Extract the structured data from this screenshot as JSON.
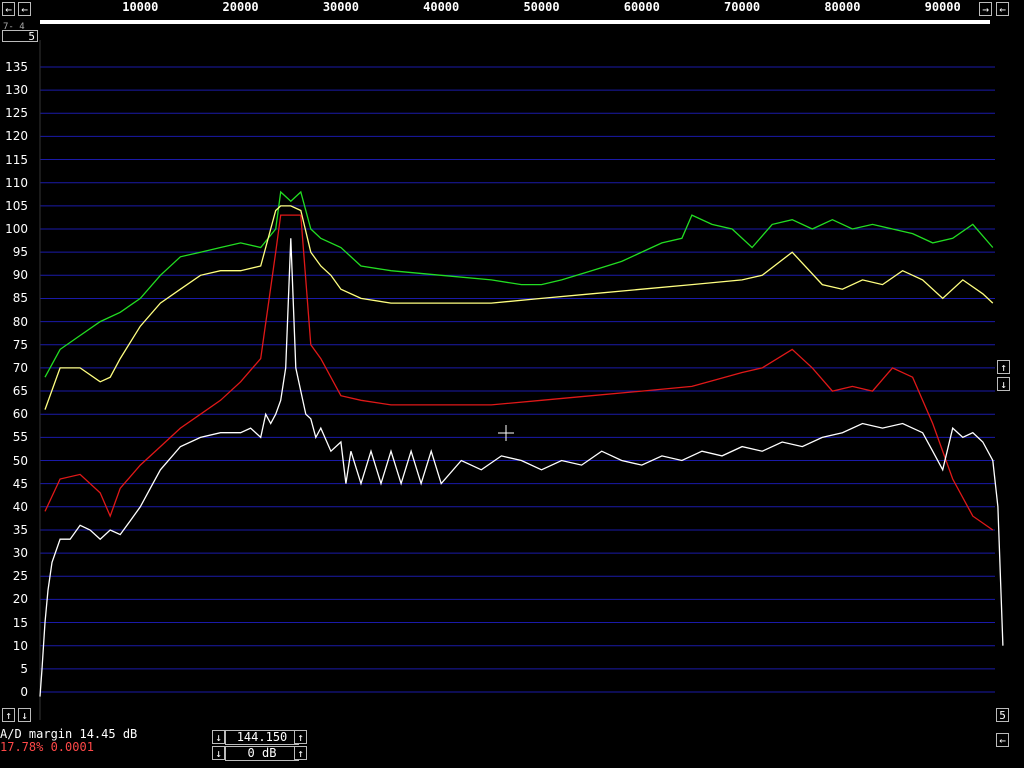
{
  "x_axis": {
    "ticks": [
      "10000",
      "20000",
      "30000",
      "40000",
      "50000",
      "60000",
      "70000",
      "80000",
      "90000"
    ],
    "scroll_left": "←",
    "scroll_right_arrow": "→",
    "scroll_right_end": "←"
  },
  "top_left_readout": "5",
  "top_left_fragment": "7- 4",
  "y_axis": {
    "ticks": [
      "135",
      "130",
      "125",
      "120",
      "115",
      "110",
      "105",
      "100",
      "95",
      "90",
      "85",
      "80",
      "75",
      "70",
      "65",
      "60",
      "55",
      "50",
      "45",
      "40",
      "35",
      "30",
      "25",
      "20",
      "15",
      "10",
      "5",
      "0"
    ]
  },
  "right_controls": {
    "up": "↑",
    "down": "↓",
    "bottom_value": "5",
    "bottom_arrow": "←"
  },
  "left_controls": {
    "up": "↑",
    "down": "↓"
  },
  "status": {
    "ad_margin": "A/D margin 14.45 dB",
    "ratio": "17.78% 0.0001"
  },
  "level_control": {
    "top_value": "144.150",
    "bottom_value": "0 dB",
    "down": "↓",
    "up": "↑"
  },
  "colors": {
    "grid": "#1a1aa8",
    "green_trace": "#22dd22",
    "yellow_trace": "#ffff80",
    "red_trace": "#e01818",
    "white_trace": "#ffffff"
  },
  "chart_data": {
    "type": "line",
    "xlim": [
      0,
      96000
    ],
    "ylim": [
      0,
      135
    ],
    "grid": true,
    "series": [
      {
        "key": "green",
        "x": [
          500,
          2000,
          4000,
          6000,
          8000,
          10000,
          12000,
          14000,
          16000,
          18000,
          20000,
          22000,
          23500,
          24000,
          25000,
          26000,
          27000,
          28000,
          30000,
          32000,
          35000,
          40000,
          45000,
          48000,
          50000,
          52000,
          55000,
          58000,
          61000,
          62000,
          64000,
          65000,
          67000,
          69000,
          71000,
          73000,
          75000,
          77000,
          79000,
          81000,
          83000,
          85000,
          87000,
          89000,
          91000,
          93000,
          95000
        ],
        "y": [
          68,
          74,
          77,
          80,
          82,
          85,
          90,
          94,
          95,
          96,
          97,
          96,
          100,
          108,
          106,
          108,
          100,
          98,
          96,
          92,
          91,
          90,
          89,
          88,
          88,
          89,
          91,
          93,
          96,
          97,
          98,
          103,
          101,
          100,
          96,
          101,
          102,
          100,
          102,
          100,
          101,
          100,
          99,
          97,
          98,
          101,
          96
        ]
      },
      {
        "key": "yellow",
        "x": [
          500,
          2000,
          4000,
          6000,
          7000,
          8000,
          10000,
          12000,
          14000,
          16000,
          18000,
          20000,
          22000,
          23500,
          24000,
          25000,
          26000,
          27000,
          28000,
          29000,
          30000,
          32000,
          35000,
          40000,
          45000,
          50000,
          55000,
          60000,
          65000,
          70000,
          72000,
          75000,
          78000,
          80000,
          82000,
          84000,
          86000,
          88000,
          90000,
          92000,
          94000,
          95000
        ],
        "y": [
          61,
          70,
          70,
          67,
          68,
          72,
          79,
          84,
          87,
          90,
          91,
          91,
          92,
          104,
          105,
          105,
          104,
          95,
          92,
          90,
          87,
          85,
          84,
          84,
          84,
          85,
          86,
          87,
          88,
          89,
          90,
          95,
          88,
          87,
          89,
          88,
          91,
          89,
          85,
          89,
          86,
          84
        ]
      },
      {
        "key": "red",
        "x": [
          500,
          2000,
          4000,
          6000,
          7000,
          8000,
          10000,
          12000,
          14000,
          16000,
          18000,
          20000,
          22000,
          23500,
          24000,
          25000,
          26000,
          27000,
          28000,
          30000,
          32000,
          35000,
          40000,
          45000,
          50000,
          55000,
          60000,
          65000,
          70000,
          72000,
          75000,
          77000,
          79000,
          81000,
          83000,
          85000,
          87000,
          89000,
          91000,
          93000,
          95000
        ],
        "y": [
          39,
          46,
          47,
          43,
          38,
          44,
          49,
          53,
          57,
          60,
          63,
          67,
          72,
          95,
          103,
          103,
          103,
          75,
          72,
          64,
          63,
          62,
          62,
          62,
          63,
          64,
          65,
          66,
          69,
          70,
          74,
          70,
          65,
          66,
          65,
          70,
          68,
          58,
          46,
          38,
          35
        ]
      },
      {
        "key": "white",
        "x": [
          0,
          200,
          500,
          800,
          1200,
          2000,
          3000,
          4000,
          5000,
          6000,
          7000,
          8000,
          9000,
          10000,
          11000,
          12000,
          14000,
          16000,
          18000,
          20000,
          21000,
          22000,
          22500,
          23000,
          23500,
          24000,
          24500,
          25000,
          25500,
          26000,
          26500,
          27000,
          27500,
          28000,
          29000,
          30000,
          30500,
          31000,
          32000,
          33000,
          34000,
          35000,
          36000,
          37000,
          38000,
          39000,
          40000,
          42000,
          44000,
          46000,
          48000,
          50000,
          52000,
          54000,
          56000,
          58000,
          60000,
          62000,
          64000,
          66000,
          68000,
          70000,
          72000,
          74000,
          76000,
          78000,
          80000,
          82000,
          84000,
          86000,
          88000,
          89000,
          90000,
          91000,
          92000,
          93000,
          94000,
          95000,
          95500,
          96000
        ],
        "y": [
          -1,
          5,
          15,
          22,
          28,
          33,
          33,
          36,
          35,
          33,
          35,
          34,
          37,
          40,
          44,
          48,
          53,
          55,
          56,
          56,
          57,
          55,
          60,
          58,
          60,
          63,
          70,
          98,
          70,
          65,
          60,
          59,
          55,
          57,
          52,
          54,
          45,
          52,
          45,
          52,
          45,
          52,
          45,
          52,
          45,
          52,
          45,
          50,
          48,
          51,
          50,
          48,
          50,
          49,
          52,
          50,
          49,
          51,
          50,
          52,
          51,
          53,
          52,
          54,
          53,
          55,
          56,
          58,
          57,
          58,
          56,
          52,
          48,
          57,
          55,
          56,
          54,
          50,
          40,
          10
        ]
      }
    ]
  }
}
